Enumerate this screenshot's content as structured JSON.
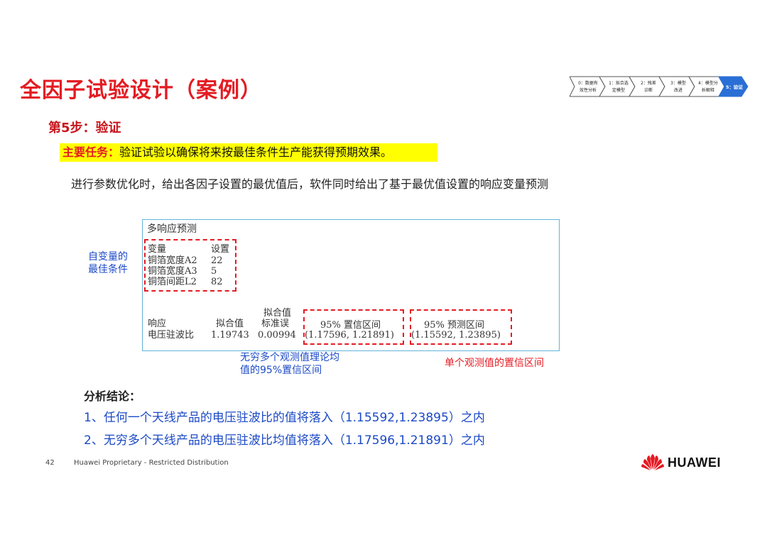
{
  "header": {
    "title": "全因子试验设计（案例）",
    "step": "第5步：验证"
  },
  "process": {
    "steps": [
      {
        "label_line1": "0：数据有",
        "label_line2": "效性分析"
      },
      {
        "label_line1": "1：拟合选",
        "label_line2": "定模型"
      },
      {
        "label_line1": "2：残差",
        "label_line2": "诊断"
      },
      {
        "label_line1": "3：模型",
        "label_line2": "改进"
      },
      {
        "label_line1": "4：模型分",
        "label_line2": "析解释"
      },
      {
        "label_line1": "5：验证",
        "label_line2": ""
      }
    ],
    "active_index": 5,
    "active_color": "#2a6fd6"
  },
  "task": {
    "lead": "主要任务：",
    "text": "验证试验以确保将来按最佳条件生产能获得预期效果。"
  },
  "intro": "进行参数优化时，给出各因子设置的最优值后，软件同时给出了基于最优值设置的响应变量预测",
  "panel": {
    "title": "多响应预测",
    "var_header": "变量",
    "set_header": "设置",
    "variables": [
      {
        "name": "铜箔宽度A2",
        "setting": "22"
      },
      {
        "name": "铜箔宽度A3",
        "setting": "5"
      },
      {
        "name": "铜箔间距L2",
        "setting": "82"
      }
    ],
    "resp_header": "响应",
    "fit_header": "拟合值",
    "se_header_1": "拟合值",
    "se_header_2": "标准误",
    "ci_header": "95% 置信区间",
    "pi_header": "95% 预测区间",
    "response": {
      "name": "电压驻波比",
      "fit": "1.19743",
      "se": "0.00994",
      "ci": "(1.17596, 1.21891)",
      "pi": "(1.15592, 1.23895)"
    }
  },
  "annotations": {
    "left_line1": "自变量的",
    "left_line2": "最佳条件",
    "ci_line1": "无穷多个观测值理论均",
    "ci_line2": "值的95%置信区间",
    "pi_note": "单个观测值的置信区间"
  },
  "conclusion": {
    "title": "分析结论：",
    "items": [
      "1、任何一个天线产品的电压驻波比的值将落入（1.15592,1.23895）之内",
      "2、无穷多个天线产品的电压驻波比均值将落入（1.17596,1.21891）之内"
    ]
  },
  "footer": {
    "page": "42",
    "text": "Huawei Proprietary - Restricted Distribution",
    "brand": "HUAWEI",
    "brand_color": "#e41b23"
  }
}
